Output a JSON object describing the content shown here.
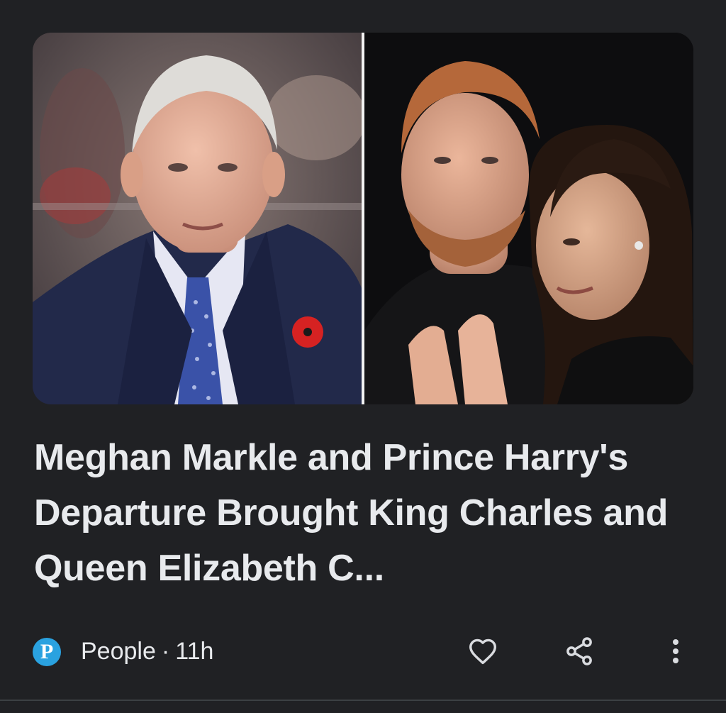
{
  "card": {
    "image": {
      "alt": "King Charles on the left; Prince Harry and Meghan Markle on the right",
      "left_subject": "king-charles",
      "right_subjects": [
        "prince-harry",
        "meghan-markle"
      ]
    },
    "headline": "Meghan Markle and Prince Harry's Departure Brought King Charles and Queen Elizabeth C...",
    "publisher": {
      "name": "People",
      "logo_letter": "P",
      "logo_color": "#2aa2e0"
    },
    "separator": "·",
    "age": "11h",
    "actions": {
      "like_icon": "heart-outline-icon",
      "share_icon": "share-icon",
      "more_icon": "more-vertical-icon"
    }
  },
  "theme": {
    "background": "#202124",
    "text": "#e8eaed",
    "icon": "#dadce0"
  }
}
